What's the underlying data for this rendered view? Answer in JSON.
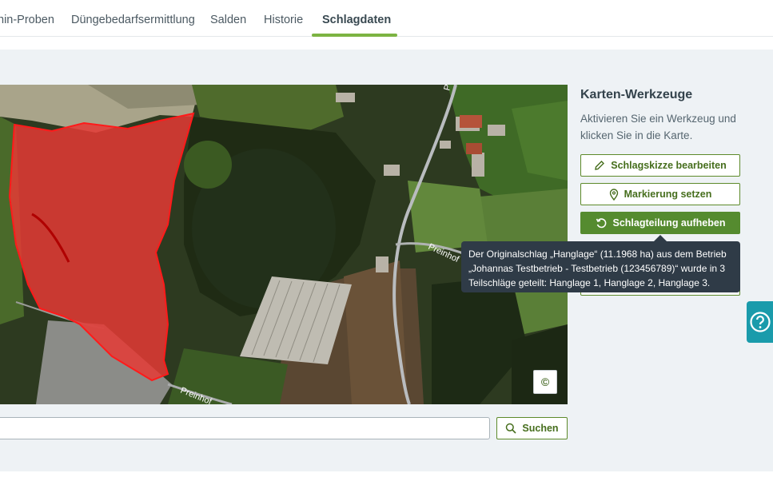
{
  "nav": {
    "tabs": [
      {
        "label": "hin-Proben"
      },
      {
        "label": "Düngebedarfsermittlung"
      },
      {
        "label": "Salden"
      },
      {
        "label": "Historie"
      },
      {
        "label": "Schlagdaten"
      }
    ],
    "active_tab": "Schlagdaten",
    "accent_color": "#7cb342"
  },
  "map": {
    "road_labels": [
      "Preinhof",
      "Preinhof",
      "Preinhof"
    ],
    "copyright_symbol": "©",
    "field_color": "#e53935"
  },
  "tools": {
    "title": "Karten-Werkzeuge",
    "description": "Aktivieren Sie ein Werkzeug und klicken Sie in die Karte.",
    "buttons": [
      {
        "label": "Schlagskizze bearbeiten",
        "icon": "pencil-icon"
      },
      {
        "label": "Markierung setzen",
        "icon": "map-pin-icon"
      },
      {
        "label": "Schlagteilung aufheben",
        "icon": "undo-icon"
      }
    ]
  },
  "tooltip": {
    "line1": "Der Originalschlag „Hanglage“ (11.1968 ha) aus dem Betrieb",
    "line2": "„Johannas Testbetrieb - Testbetrieb (123456789)“ wurde in 3",
    "line3": "Teilschläge geteilt: Hanglage 1, Hanglage 2, Hanglage 3."
  },
  "search": {
    "value": "",
    "button_label": "Suchen",
    "icon": "search-icon"
  },
  "help": {
    "icon": "help-icon",
    "color": "#1a9bab"
  }
}
